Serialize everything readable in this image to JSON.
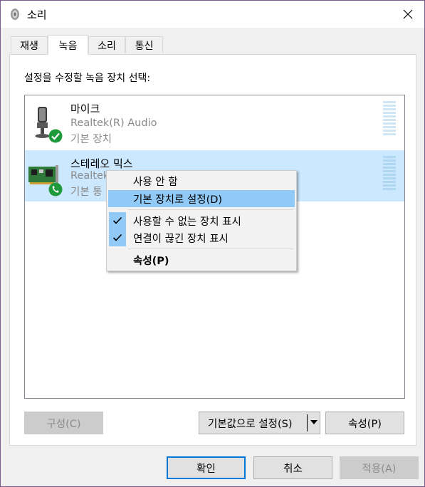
{
  "window": {
    "title": "소리"
  },
  "tabs": [
    {
      "label": "재생",
      "active": false
    },
    {
      "label": "녹음",
      "active": true
    },
    {
      "label": "소리",
      "active": false
    },
    {
      "label": "통신",
      "active": false
    }
  ],
  "prompt": "설정을 수정할 녹음 장치 선택:",
  "devices": [
    {
      "name": "마이크",
      "driver": "Realtek(R) Audio",
      "status": "기본 장치",
      "icon": "microphone-icon",
      "badge": "check-badge-icon",
      "selected": false
    },
    {
      "name": "스테레오 믹스",
      "driver": "Realtek",
      "status": "기본 통",
      "icon": "sound-card-icon",
      "badge": "phone-badge-icon",
      "selected": true
    }
  ],
  "context_menu": {
    "items": [
      {
        "label": "사용 안 함",
        "checked": false,
        "highlighted": false
      },
      {
        "label": "기본 장치로 설정(D)",
        "checked": false,
        "highlighted": true
      },
      {
        "label": "사용할 수 없는 장치 표시",
        "checked": true,
        "highlighted": false
      },
      {
        "label": "연결이 끊긴 장치 표시",
        "checked": true,
        "highlighted": false
      },
      {
        "label": "속성(P)",
        "checked": false,
        "highlighted": false,
        "bold": true
      }
    ]
  },
  "panel_buttons": {
    "configure": "구성(C)",
    "set_default": "기본값으로 설정(S)",
    "properties": "속성(P)"
  },
  "dialog_buttons": {
    "ok": "확인",
    "cancel": "취소",
    "apply": "적용(A)"
  },
  "colors": {
    "selection": "#cce8ff",
    "menu_highlight": "#91c9f7",
    "focus_border": "#0078d7",
    "badge_green": "#1e9a3b"
  }
}
